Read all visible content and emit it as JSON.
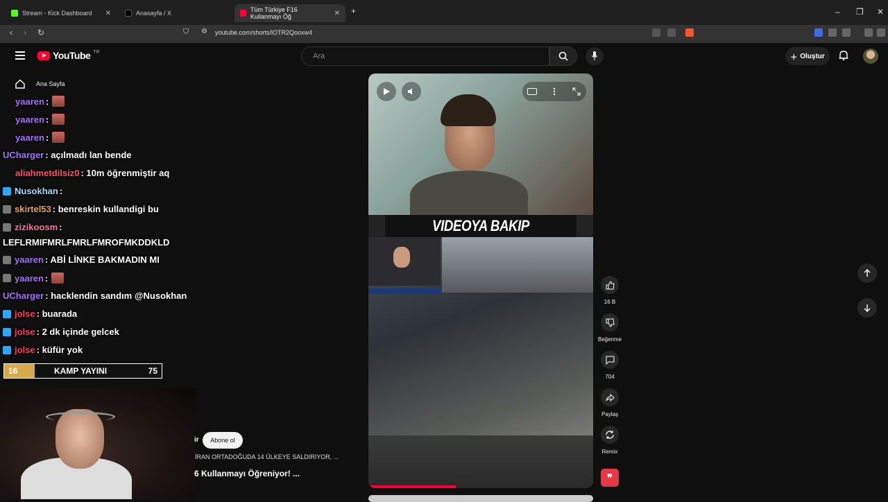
{
  "browser": {
    "tabs": [
      {
        "label": "Stream - Kick Dashboard",
        "color": "#53fc18"
      },
      {
        "label": "Anasayfa / X",
        "color": "#000000"
      },
      {
        "label": "Tüm Türkiye F16 Kullanmayı Öğ",
        "color": "#ff0033"
      }
    ],
    "new_tab": "+",
    "url": "youtube.com/shorts/lOTR2Qooxw4"
  },
  "youtube": {
    "logo_word": "YouTube",
    "logo_region": "TR",
    "search_placeholder": "Ara",
    "create_label": "Oluştur",
    "sidebar": [
      {
        "label": "Ana Sayfa",
        "icon": "home-icon"
      }
    ]
  },
  "chat": [
    {
      "user": "yaaren",
      "user_color": "#a970ff",
      "text": " :",
      "badge": "",
      "emote": true
    },
    {
      "user": "yaaren",
      "user_color": "#a970ff",
      "text": " :",
      "badge": "",
      "emote": true
    },
    {
      "user": "yaaren",
      "user_color": "#a970ff",
      "text": " :",
      "badge": "",
      "emote": true
    },
    {
      "user": "UCharger",
      "user_color": "#a970ff",
      "text": " : açılmadı lan bende",
      "badge": "",
      "emote": false
    },
    {
      "user": "aliahmetdilsiz0",
      "user_color": "#ff4f6a",
      "text": " : 10m öğrenmiştir aq",
      "badge": "",
      "emote": false
    },
    {
      "user": "Nusokhan",
      "user_color": "#a8d8ff",
      "text": " :",
      "badge": "#2aa7ff",
      "emote": true
    },
    {
      "user": "skirtel53",
      "user_color": "#e8a838",
      "text": " : benreskin kullandigi bu",
      "badge": "",
      "emote": false
    },
    {
      "user": "zizikoosm",
      "user_color": "#ff6fa5",
      "text": " :",
      "badge": "",
      "emote": false
    },
    {
      "user": "",
      "user_color": "#ffffff",
      "text": "LEFLRMIFMRLFMRLFMROFMKDDKLD",
      "badge": "",
      "emote": false
    },
    {
      "user": "yaaren",
      "user_color": "#a970ff",
      "text": " : ABİ LİNKE BAKMADIN MI",
      "badge": "",
      "emote": false
    },
    {
      "user": "yaaren",
      "user_color": "#a970ff",
      "text": " :",
      "badge": "",
      "emote": true
    },
    {
      "user": "UCharger",
      "user_color": "#a970ff",
      "text": " : hacklendin sandım @Nusokhan",
      "badge": "",
      "emote": false
    },
    {
      "user": "jolse",
      "user_color": "#ff3b5c",
      "text": " : buarada",
      "badge": "#2aa7ff",
      "emote": false
    },
    {
      "user": "jolse",
      "user_color": "#ff3b5c",
      "text": " : 2 dk içinde gelcek",
      "badge": "#2aa7ff",
      "emote": false
    },
    {
      "user": "jolse",
      "user_color": "#ff3b5c",
      "text": " : küfür yok",
      "badge": "#2aa7ff",
      "emote": false
    }
  ],
  "poll": {
    "left_value": "16",
    "title": "KAMP YAYINI",
    "right_value": "75"
  },
  "shorts": {
    "channel_prefix": "ir",
    "subscribe": "Abone ol",
    "subtitle": "İRAN ORTADOĞUDA 14 ÜLKEYE SALDIRIYOR, ...",
    "title": "6 Kullanmayı Öğreniyor! ...",
    "banner_text": "VIDEOYA BAKIP",
    "progress_fraction": 0.39,
    "actions": [
      {
        "label": "16 B",
        "icon": "like-icon"
      },
      {
        "label": "Beğenme",
        "icon": "dislike-icon"
      },
      {
        "label": "704",
        "icon": "comment-icon"
      },
      {
        "label": "Paylaş",
        "icon": "share-icon"
      },
      {
        "label": "Remix",
        "icon": "remix-icon"
      }
    ]
  }
}
